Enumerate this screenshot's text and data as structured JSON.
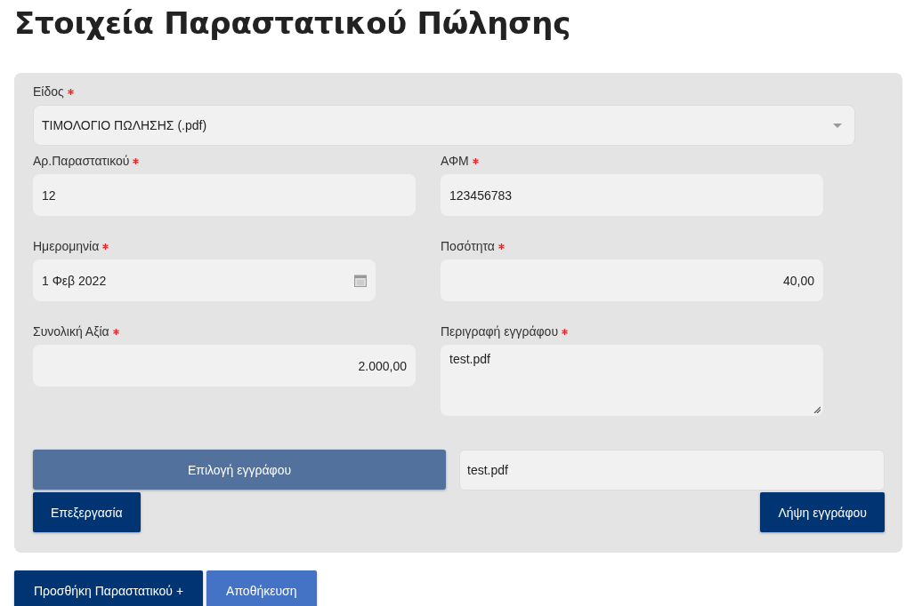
{
  "title": "Στοιχεία Παραστατικού Πώλησης",
  "fields": [
    {
      "kind": "select",
      "label": "Είδος",
      "required": true,
      "value": "ΤΙΜΟΛΟΓΙΟ ΠΩΛΗΣΗΣ (.pdf)"
    },
    {
      "kind": "text",
      "label": "Αρ.Παραστατικού",
      "required": true,
      "value": "12"
    },
    {
      "kind": "text",
      "label": "ΑΦΜ",
      "required": true,
      "value": "123456783"
    },
    {
      "kind": "date",
      "label": "Ημερομηνία",
      "required": true,
      "value": "1 Φεβ 2022"
    },
    {
      "kind": "number",
      "label": "Ποσότητα",
      "required": true,
      "value": "40,00"
    },
    {
      "kind": "number",
      "label": "Συνολική Αξία",
      "required": true,
      "value": "2.000,00"
    },
    {
      "kind": "textarea",
      "label": "Περιγραφή εγγράφου",
      "required": true,
      "value": "test.pdf"
    }
  ],
  "upload": {
    "button": "Επιλογή εγγράφου",
    "file_name": "test.pdf",
    "edit_button": "Επεξεργασία",
    "download_button": "Λήψη εγγράφου"
  },
  "actions": [
    {
      "label": "Προσθήκη Παραστατικού +",
      "kind": "primary"
    },
    {
      "label": "Αποθήκευση",
      "kind": "secondary"
    }
  ]
}
